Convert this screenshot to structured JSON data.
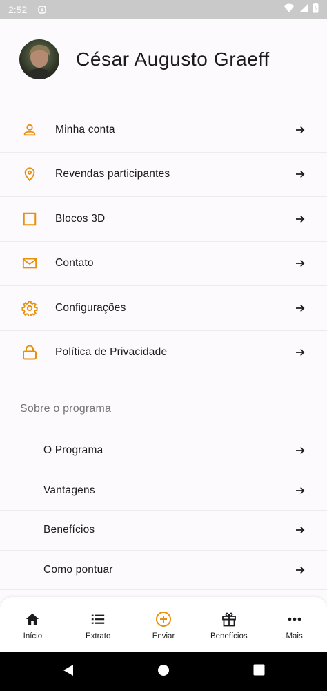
{
  "status_bar": {
    "time": "2:52"
  },
  "profile": {
    "name": "César Augusto Graeff"
  },
  "menu": {
    "items": [
      {
        "label": "Minha conta",
        "icon": "person-icon"
      },
      {
        "label": "Revendas participantes",
        "icon": "location-pin-icon"
      },
      {
        "label": "Blocos 3D",
        "icon": "square-icon"
      },
      {
        "label": "Contato",
        "icon": "mail-icon"
      },
      {
        "label": "Configurações",
        "icon": "gear-icon"
      },
      {
        "label": "Política de Privacidade",
        "icon": "lock-icon"
      }
    ]
  },
  "about": {
    "title": "Sobre o programa",
    "items": [
      {
        "label": "O Programa"
      },
      {
        "label": "Vantagens"
      },
      {
        "label": "Benefícios"
      },
      {
        "label": "Como pontuar"
      }
    ]
  },
  "bottom_nav": {
    "items": [
      {
        "label": "Início",
        "icon": "home-icon"
      },
      {
        "label": "Extrato",
        "icon": "list-icon"
      },
      {
        "label": "Enviar",
        "icon": "add-circle-icon"
      },
      {
        "label": "Benefícios",
        "icon": "gift-icon"
      },
      {
        "label": "Mais",
        "icon": "more-icon"
      }
    ]
  },
  "colors": {
    "accent": "#e8900c",
    "text": "#1b1b1f",
    "muted": "#77757a",
    "background": "#fcfafc"
  }
}
